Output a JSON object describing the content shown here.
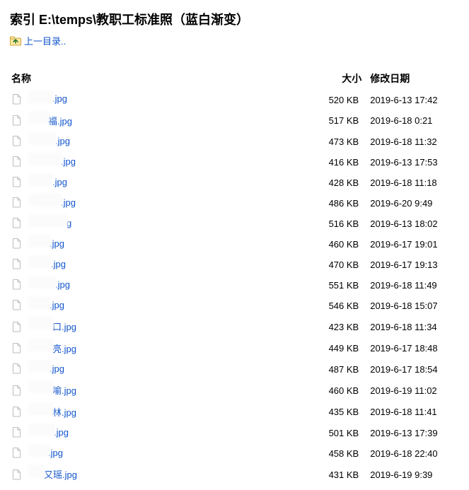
{
  "header": {
    "title_prefix": "索引 ",
    "path": "E:\\temps\\教职工标准照（蓝白渐变）",
    "parent_label": "上一目录.."
  },
  "columns": {
    "name": "名称",
    "size": "大小",
    "date": "修改日期"
  },
  "files": [
    {
      "name": ".jpg",
      "size": "520 KB",
      "date": "2019-6-13 17:42",
      "smudge_w": 36
    },
    {
      "name": "福.jpg",
      "size": "517 KB",
      "date": "2019-6-18 0:21",
      "smudge_w": 30
    },
    {
      "name": ".jpg",
      "size": "473 KB",
      "date": "2019-6-18 11:32",
      "smudge_w": 40
    },
    {
      "name": ".jpg",
      "size": "416 KB",
      "date": "2019-6-13 17:53",
      "smudge_w": 48
    },
    {
      "name": ".jpg",
      "size": "428 KB",
      "date": "2019-6-18 11:18",
      "smudge_w": 36
    },
    {
      "name": ".jpg",
      "size": "486 KB",
      "date": "2019-6-20 9:49",
      "smudge_w": 48
    },
    {
      "name": "g",
      "size": "516 KB",
      "date": "2019-6-13 18:02",
      "smudge_w": 56
    },
    {
      "name": ".jpg",
      "size": "460 KB",
      "date": "2019-6-17 19:01",
      "smudge_w": 32
    },
    {
      "name": ".jpg",
      "size": "470 KB",
      "date": "2019-6-17 19:13",
      "smudge_w": 34
    },
    {
      "name": ".jpg",
      "size": "551 KB",
      "date": "2019-6-18 11:49",
      "smudge_w": 40
    },
    {
      "name": ".jpg",
      "size": "546 KB",
      "date": "2019-6-18 15:07",
      "smudge_w": 32
    },
    {
      "name": "口.jpg",
      "size": "423 KB",
      "date": "2019-6-18 11:34",
      "smudge_w": 36
    },
    {
      "name": "亮.jpg",
      "size": "449 KB",
      "date": "2019-6-17 18:48",
      "smudge_w": 36
    },
    {
      "name": ".jpg",
      "size": "487 KB",
      "date": "2019-6-17 18:54",
      "smudge_w": 32
    },
    {
      "name": "喻.jpg",
      "size": "460 KB",
      "date": "2019-6-19 11:02",
      "smudge_w": 36
    },
    {
      "name": "林.jpg",
      "size": "435 KB",
      "date": "2019-6-18 11:41",
      "smudge_w": 36
    },
    {
      "name": ".jpg",
      "size": "501 KB",
      "date": "2019-6-13 17:39",
      "smudge_w": 38
    },
    {
      "name": ".jpg",
      "size": "458 KB",
      "date": "2019-6-18 22:40",
      "smudge_w": 30
    },
    {
      "name": "又瑶.jpg",
      "size": "431 KB",
      "date": "2019-6-19 9:39",
      "smudge_w": 24
    }
  ]
}
